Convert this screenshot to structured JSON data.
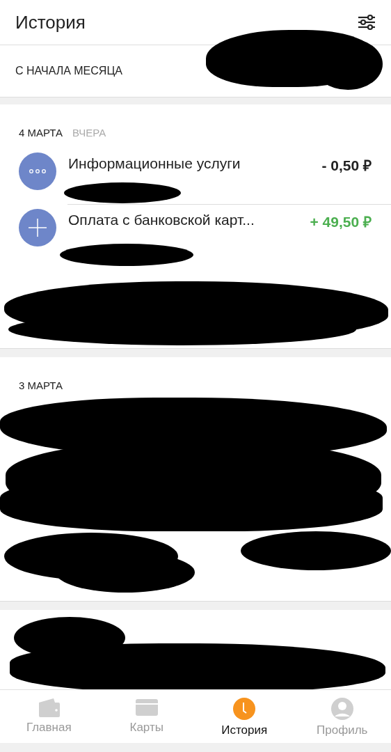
{
  "header": {
    "title": "История"
  },
  "summary": {
    "label": "С НАЧАЛА МЕСЯЦА"
  },
  "days": [
    {
      "date": "4 МАРТА",
      "relative": "ВЧЕРА",
      "transactions": [
        {
          "kind": "debit",
          "title": "Информационные услуги",
          "amount": "- 0,50 ₽"
        },
        {
          "kind": "credit",
          "title": "Оплата с банковской карт...",
          "amount": "+ 49,50 ₽"
        }
      ]
    },
    {
      "date": "3 МАРТА"
    }
  ],
  "tabs": [
    {
      "label": "Главная",
      "selected": false
    },
    {
      "label": "Карты",
      "selected": false
    },
    {
      "label": "История",
      "selected": true
    },
    {
      "label": "Профиль",
      "selected": false
    }
  ]
}
